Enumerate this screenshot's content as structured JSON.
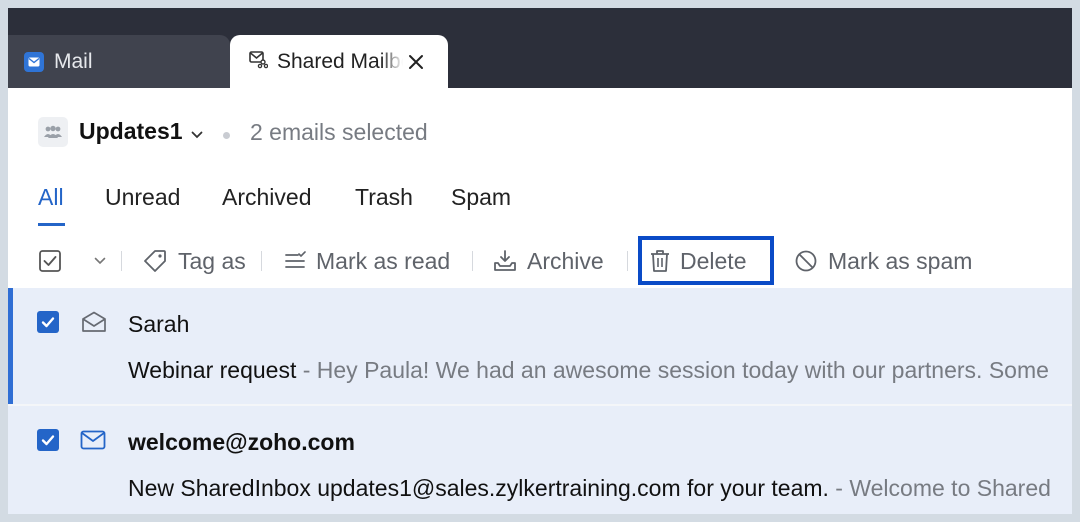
{
  "tabs": [
    {
      "label": "Mail",
      "icon": "mail-icon"
    },
    {
      "label": "Shared Mailbox",
      "icon": "shared-mailbox-icon",
      "active": true
    }
  ],
  "header": {
    "mailbox_name": "Updates1",
    "selection_status": "2 emails selected"
  },
  "filters": [
    "All",
    "Unread",
    "Archived",
    "Trash",
    "Spam"
  ],
  "active_filter": "All",
  "toolbar": {
    "tag_label": "Tag as",
    "mark_read_label": "Mark as read",
    "archive_label": "Archive",
    "delete_label": "Delete",
    "spam_label": "Mark as spam"
  },
  "emails": [
    {
      "sender": "Sarah",
      "subject": "Webinar request",
      "snippet": " - Hey Paula! We had an awesome session today with our partners. Some",
      "checked": true,
      "read": true
    },
    {
      "sender": "welcome@zoho.com",
      "subject": "New SharedInbox updates1@sales.zylkertraining.com for your team.",
      "snippet": " - Welcome to Shared",
      "checked": true,
      "read": false
    }
  ],
  "colors": {
    "accent": "#2465c8",
    "highlight_border": "#0a4bc7",
    "selected_row": "#e8eef9",
    "tabbar": "#2c2f3a"
  }
}
